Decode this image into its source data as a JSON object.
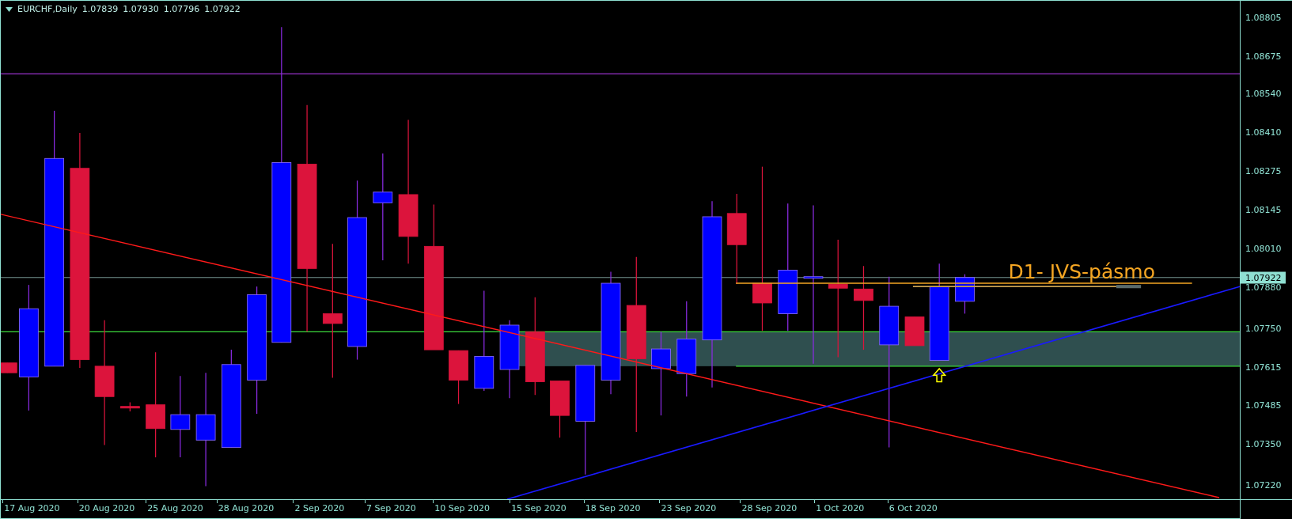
{
  "header": {
    "symbol": "EURCHF,Daily",
    "quotes": [
      "1.07839",
      "1.07930",
      "1.07796",
      "1.07922"
    ]
  },
  "price_axis": {
    "labels": [
      "1.08805",
      "1.08675",
      "1.08540",
      "1.08410",
      "1.08275",
      "1.08145",
      "1.08010",
      "1.07880",
      "1.07750",
      "1.07615",
      "1.07485",
      "1.07350",
      "1.07220"
    ],
    "current_price": "1.07922"
  },
  "date_axis": [
    "17 Aug 2020",
    "20 Aug 2020",
    "25 Aug 2020",
    "28 Aug 2020",
    "2 Sep 2020",
    "7 Sep 2020",
    "10 Sep 2020",
    "15 Sep 2020",
    "18 Sep 2020",
    "23 Sep 2020",
    "28 Sep 2020",
    "1 Oct 2020",
    "6 Oct 2020"
  ],
  "annotation": "D1- JVS-pásmo"
}
